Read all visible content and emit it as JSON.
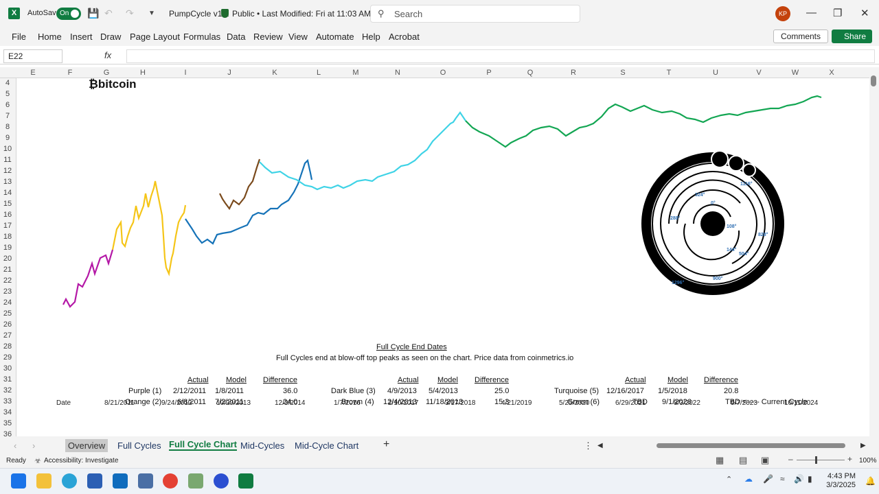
{
  "titlebar": {
    "autosave_label": "AutoSave",
    "autosave_state": "On",
    "doc_name": "PumpCycle v1.1",
    "doc_status": "Public • Last Modified: Fri at 11:03 AM",
    "search_placeholder": "Search",
    "user_initials": "KP"
  },
  "menu": {
    "items": [
      "File",
      "Home",
      "Insert",
      "Draw",
      "Page Layout",
      "Formulas",
      "Data",
      "Review",
      "View",
      "Automate",
      "Help",
      "Acrobat"
    ],
    "comments_label": "Comments",
    "share_label": "Share"
  },
  "formula_bar": {
    "name_box": "E22",
    "fx": "fx",
    "formula": ""
  },
  "columns": [
    "E",
    "F",
    "G",
    "H",
    "I",
    "J",
    "K",
    "L",
    "M",
    "N",
    "O",
    "P",
    "Q",
    "R",
    "S",
    "T",
    "U",
    "V",
    "W",
    "X"
  ],
  "rows": [
    "4",
    "5",
    "6",
    "7",
    "8",
    "9",
    "10",
    "11",
    "12",
    "13",
    "14",
    "15",
    "16",
    "17",
    "18",
    "19",
    "20",
    "21",
    "22",
    "23",
    "24",
    "25",
    "26",
    "27",
    "28",
    "29",
    "30",
    "31",
    "32",
    "33",
    "34",
    "35",
    "36"
  ],
  "chart": {
    "logo_text": "bitcoin",
    "x_labels": [
      "Date",
      "8/21/2011",
      "9/24/2012",
      "10/29/2013",
      "12/3/2014",
      "1/7/2016",
      "2/10/2017",
      "3/17/2018",
      "4/21/2019",
      "5/25/2020",
      "6/29/2021",
      "8/3/2022",
      "9/7/2023",
      "10/11/2024"
    ],
    "series_colors": {
      "purple": "#b418a6",
      "orange": "#f5c518",
      "dark_blue": "#1673b8",
      "brown": "#7a4a1c",
      "turquoise": "#3fd3e6",
      "green": "#13a653"
    },
    "dial_labels": [
      "0°",
      "108°",
      "144°",
      "288°",
      "324°",
      "504°",
      "828°",
      "900°",
      "1116°",
      "1296°"
    ]
  },
  "table": {
    "title": "Full Cycle End Dates",
    "subtitle": "Full Cycles end at blow-off top peaks as seen on the chart. Price data from coinmetrics.io",
    "headers": [
      "Actual",
      "Model",
      "Difference"
    ],
    "groups": [
      {
        "rows": [
          {
            "name": "Purple (1)",
            "actual": "2/12/2011",
            "model": "1/8/2011",
            "diff": "36.0"
          },
          {
            "name": "Orange (2)",
            "actual": "6/8/2011",
            "model": "7/2/2011",
            "diff": "24.0"
          }
        ]
      },
      {
        "rows": [
          {
            "name": "Dark Blue (3)",
            "actual": "4/9/2013",
            "model": "5/4/2013",
            "diff": "25.0"
          },
          {
            "name": "Brown (4)",
            "actual": "12/4/2013",
            "model": "11/18/2013",
            "diff": "15.3"
          }
        ]
      },
      {
        "rows": [
          {
            "name": "Turquoise (5)",
            "actual": "12/16/2017",
            "model": "1/5/2018",
            "diff": "20.8"
          },
          {
            "name": "Green (6)",
            "actual": "TBD",
            "model": "9/1/2026",
            "diff": "TBD"
          }
        ]
      }
    ],
    "current_note": "<----- Current Cycle"
  },
  "sheet_tabs": [
    "Overview",
    "Full Cycles",
    "Full Cycle Chart",
    "Mid-Cycles",
    "Mid-Cycle Chart"
  ],
  "active_tab": "Full Cycle Chart",
  "status": {
    "ready": "Ready",
    "accessibility": "Accessibility: Investigate",
    "zoom": "100%"
  },
  "clock": {
    "time": "4:43 PM",
    "date": "3/3/2025"
  }
}
